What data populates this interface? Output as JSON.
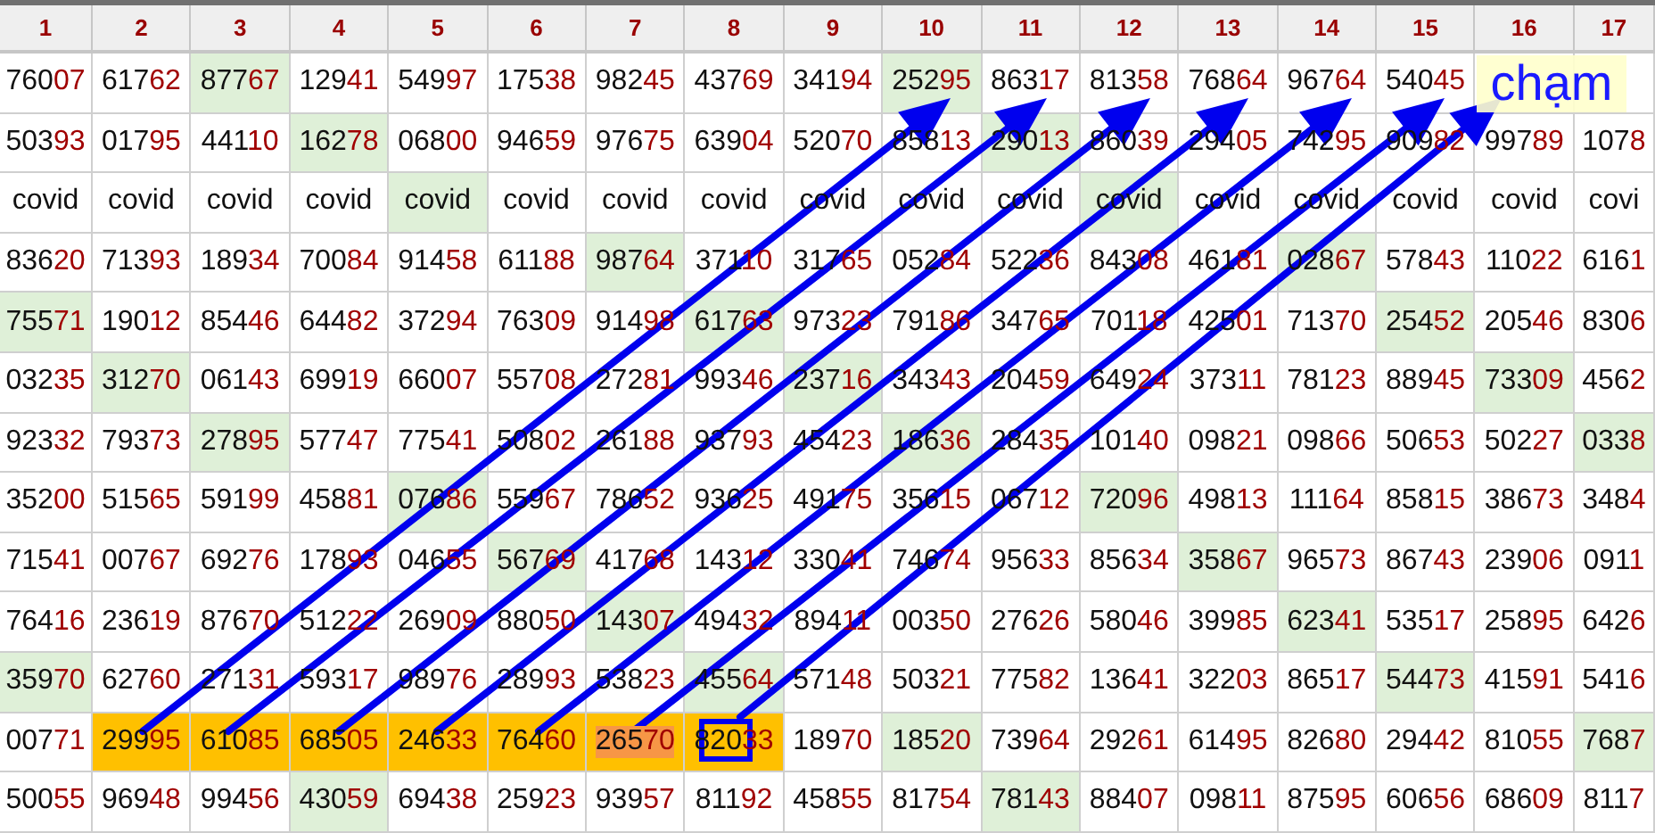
{
  "columns": [
    "1",
    "2",
    "3",
    "4",
    "5",
    "6",
    "7",
    "8",
    "9",
    "10",
    "11",
    "12",
    "13",
    "14",
    "15",
    "16",
    "17"
  ],
  "rows": [
    {
      "kind": "numbers",
      "cells": [
        {
          "text": "76007"
        },
        {
          "text": "61762"
        },
        {
          "text": "87767",
          "color": "#dff0d8"
        },
        {
          "text": "12941"
        },
        {
          "text": "54997"
        },
        {
          "text": "17538"
        },
        {
          "text": "98245"
        },
        {
          "text": "43769"
        },
        {
          "text": "34194"
        },
        {
          "text": "25295",
          "color": "#dff0d8"
        },
        {
          "text": "86317"
        },
        {
          "text": "81358"
        },
        {
          "text": "76864"
        },
        {
          "text": "96764"
        },
        {
          "text": "54045"
        }
      ]
    },
    {
      "kind": "numbers",
      "cells": [
        {
          "text": "50393"
        },
        {
          "text": "01795"
        },
        {
          "text": "44110"
        },
        {
          "text": "16278",
          "color": "#dff0d8"
        },
        {
          "text": "06800"
        },
        {
          "text": "94659"
        },
        {
          "text": "97675"
        },
        {
          "text": "63904"
        },
        {
          "text": "52070"
        },
        {
          "text": "85813"
        },
        {
          "text": "29013",
          "color": "#dff0d8"
        },
        {
          "text": "86039"
        },
        {
          "text": "29405"
        },
        {
          "text": "74295"
        },
        {
          "text": "90982"
        },
        {
          "text": "99789"
        },
        {
          "text": "1078"
        }
      ]
    },
    {
      "kind": "words",
      "cells": [
        {
          "text": "covid"
        },
        {
          "text": "covid"
        },
        {
          "text": "covid"
        },
        {
          "text": "covid"
        },
        {
          "text": "covid",
          "color": "#dff0d8"
        },
        {
          "text": "covid"
        },
        {
          "text": "covid"
        },
        {
          "text": "covid"
        },
        {
          "text": "covid"
        },
        {
          "text": "covid"
        },
        {
          "text": "covid"
        },
        {
          "text": "covid",
          "color": "#dff0d8"
        },
        {
          "text": "covid"
        },
        {
          "text": "covid"
        },
        {
          "text": "covid"
        },
        {
          "text": "covid"
        },
        {
          "text": "covi"
        }
      ]
    },
    {
      "kind": "numbers",
      "cells": [
        {
          "text": "83620"
        },
        {
          "text": "71393"
        },
        {
          "text": "18934"
        },
        {
          "text": "70084"
        },
        {
          "text": "91458"
        },
        {
          "text": "61188"
        },
        {
          "text": "98764",
          "color": "#dff0d8"
        },
        {
          "text": "37110"
        },
        {
          "text": "31765"
        },
        {
          "text": "05284"
        },
        {
          "text": "52236"
        },
        {
          "text": "84308"
        },
        {
          "text": "46181"
        },
        {
          "text": "02867",
          "color": "#dff0d8"
        },
        {
          "text": "57843"
        },
        {
          "text": "11022"
        },
        {
          "text": "6161"
        }
      ]
    },
    {
      "kind": "numbers",
      "cells": [
        {
          "text": "75571",
          "color": "#dff0d8"
        },
        {
          "text": "19012"
        },
        {
          "text": "85446"
        },
        {
          "text": "64482"
        },
        {
          "text": "37294"
        },
        {
          "text": "76309"
        },
        {
          "text": "91498"
        },
        {
          "text": "61763",
          "color": "#dff0d8"
        },
        {
          "text": "97323"
        },
        {
          "text": "79186"
        },
        {
          "text": "34765"
        },
        {
          "text": "70118"
        },
        {
          "text": "42501"
        },
        {
          "text": "71370"
        },
        {
          "text": "25452",
          "color": "#dff0d8"
        },
        {
          "text": "20546"
        },
        {
          "text": "8306"
        }
      ]
    },
    {
      "kind": "numbers",
      "cells": [
        {
          "text": "03235"
        },
        {
          "text": "31270",
          "color": "#dff0d8"
        },
        {
          "text": "06143"
        },
        {
          "text": "69919"
        },
        {
          "text": "66007"
        },
        {
          "text": "55708"
        },
        {
          "text": "27281"
        },
        {
          "text": "99346"
        },
        {
          "text": "23716",
          "color": "#dff0d8"
        },
        {
          "text": "34343"
        },
        {
          "text": "20459"
        },
        {
          "text": "64924"
        },
        {
          "text": "37311"
        },
        {
          "text": "78123"
        },
        {
          "text": "88945"
        },
        {
          "text": "73309",
          "color": "#dff0d8"
        },
        {
          "text": "4562"
        }
      ]
    },
    {
      "kind": "numbers",
      "cells": [
        {
          "text": "92332"
        },
        {
          "text": "79373"
        },
        {
          "text": "27895",
          "color": "#dff0d8"
        },
        {
          "text": "57747"
        },
        {
          "text": "77541"
        },
        {
          "text": "50802"
        },
        {
          "text": "26188"
        },
        {
          "text": "93793"
        },
        {
          "text": "45423"
        },
        {
          "text": "18636",
          "color": "#dff0d8"
        },
        {
          "text": "28435"
        },
        {
          "text": "10140"
        },
        {
          "text": "09821"
        },
        {
          "text": "09866"
        },
        {
          "text": "50653"
        },
        {
          "text": "50227"
        },
        {
          "text": "0338",
          "color": "#dff0d8"
        }
      ]
    },
    {
      "kind": "numbers",
      "cells": [
        {
          "text": "35200"
        },
        {
          "text": "51565"
        },
        {
          "text": "59199"
        },
        {
          "text": "45881"
        },
        {
          "text": "07686",
          "color": "#dff0d8"
        },
        {
          "text": "55967"
        },
        {
          "text": "78652"
        },
        {
          "text": "93625"
        },
        {
          "text": "49175"
        },
        {
          "text": "35615"
        },
        {
          "text": "06712"
        },
        {
          "text": "72096",
          "color": "#dff0d8"
        },
        {
          "text": "49813"
        },
        {
          "text": "11164"
        },
        {
          "text": "85815"
        },
        {
          "text": "38673"
        },
        {
          "text": "3484"
        }
      ]
    },
    {
      "kind": "numbers",
      "cells": [
        {
          "text": "71541"
        },
        {
          "text": "00767"
        },
        {
          "text": "69276"
        },
        {
          "text": "17893"
        },
        {
          "text": "04655"
        },
        {
          "text": "56769",
          "color": "#dff0d8"
        },
        {
          "text": "41768"
        },
        {
          "text": "14312"
        },
        {
          "text": "33041"
        },
        {
          "text": "74674"
        },
        {
          "text": "95633"
        },
        {
          "text": "85634"
        },
        {
          "text": "35867",
          "color": "#dff0d8"
        },
        {
          "text": "96573"
        },
        {
          "text": "86743"
        },
        {
          "text": "23906"
        },
        {
          "text": "0911"
        }
      ]
    },
    {
      "kind": "numbers",
      "cells": [
        {
          "text": "76416"
        },
        {
          "text": "23619"
        },
        {
          "text": "87670"
        },
        {
          "text": "51222"
        },
        {
          "text": "26909"
        },
        {
          "text": "88050"
        },
        {
          "text": "14307",
          "color": "#dff0d8"
        },
        {
          "text": "49432"
        },
        {
          "text": "89411"
        },
        {
          "text": "00350"
        },
        {
          "text": "27626"
        },
        {
          "text": "58046"
        },
        {
          "text": "39985"
        },
        {
          "text": "62341",
          "color": "#dff0d8"
        },
        {
          "text": "53517"
        },
        {
          "text": "25895"
        },
        {
          "text": "6426"
        }
      ]
    },
    {
      "kind": "numbers",
      "cells": [
        {
          "text": "35970",
          "color": "#dff0d8"
        },
        {
          "text": "62760"
        },
        {
          "text": "27131"
        },
        {
          "text": "59317"
        },
        {
          "text": "98976"
        },
        {
          "text": "28993"
        },
        {
          "text": "53823"
        },
        {
          "text": "45564",
          "color": "#dff0d8"
        },
        {
          "text": "57148"
        },
        {
          "text": "50321"
        },
        {
          "text": "77582"
        },
        {
          "text": "13641"
        },
        {
          "text": "32203"
        },
        {
          "text": "86517"
        },
        {
          "text": "54473",
          "color": "#dff0d8"
        },
        {
          "text": "41591"
        },
        {
          "text": "5416"
        }
      ]
    },
    {
      "kind": "numbers",
      "cells": [
        {
          "text": "00771"
        },
        {
          "text": "29995",
          "color": "#ffc000"
        },
        {
          "text": "61085",
          "color": "#ffc000"
        },
        {
          "text": "68505",
          "color": "#ffc000"
        },
        {
          "text": "24633",
          "color": "#ffc000"
        },
        {
          "text": "76460",
          "color": "#ffc000"
        },
        {
          "text": "26570",
          "color": "#f79646",
          "text_highlighted": true
        },
        {
          "text": "82033",
          "color": "#ffc000"
        },
        {
          "text": "18970"
        },
        {
          "text": "18520",
          "color": "#dff0d8"
        },
        {
          "text": "73964"
        },
        {
          "text": "29261"
        },
        {
          "text": "61495"
        },
        {
          "text": "82680"
        },
        {
          "text": "29442"
        },
        {
          "text": "81055"
        },
        {
          "text": "7687",
          "color": "#dff0d8"
        }
      ]
    },
    {
      "kind": "numbers",
      "cells": [
        {
          "text": "50055"
        },
        {
          "text": "96948"
        },
        {
          "text": "99456"
        },
        {
          "text": "43059",
          "color": "#dff0d8"
        },
        {
          "text": "69438"
        },
        {
          "text": "25923"
        },
        {
          "text": "93957"
        },
        {
          "text": "81192"
        },
        {
          "text": "45855"
        },
        {
          "text": "81754"
        },
        {
          "text": "78143",
          "color": "#dff0d8"
        },
        {
          "text": "88407"
        },
        {
          "text": "09811"
        },
        {
          "text": "87595"
        },
        {
          "text": "60656"
        },
        {
          "text": "68609"
        },
        {
          "text": "8117"
        }
      ]
    }
  ],
  "note": {
    "text": "chạm"
  }
}
